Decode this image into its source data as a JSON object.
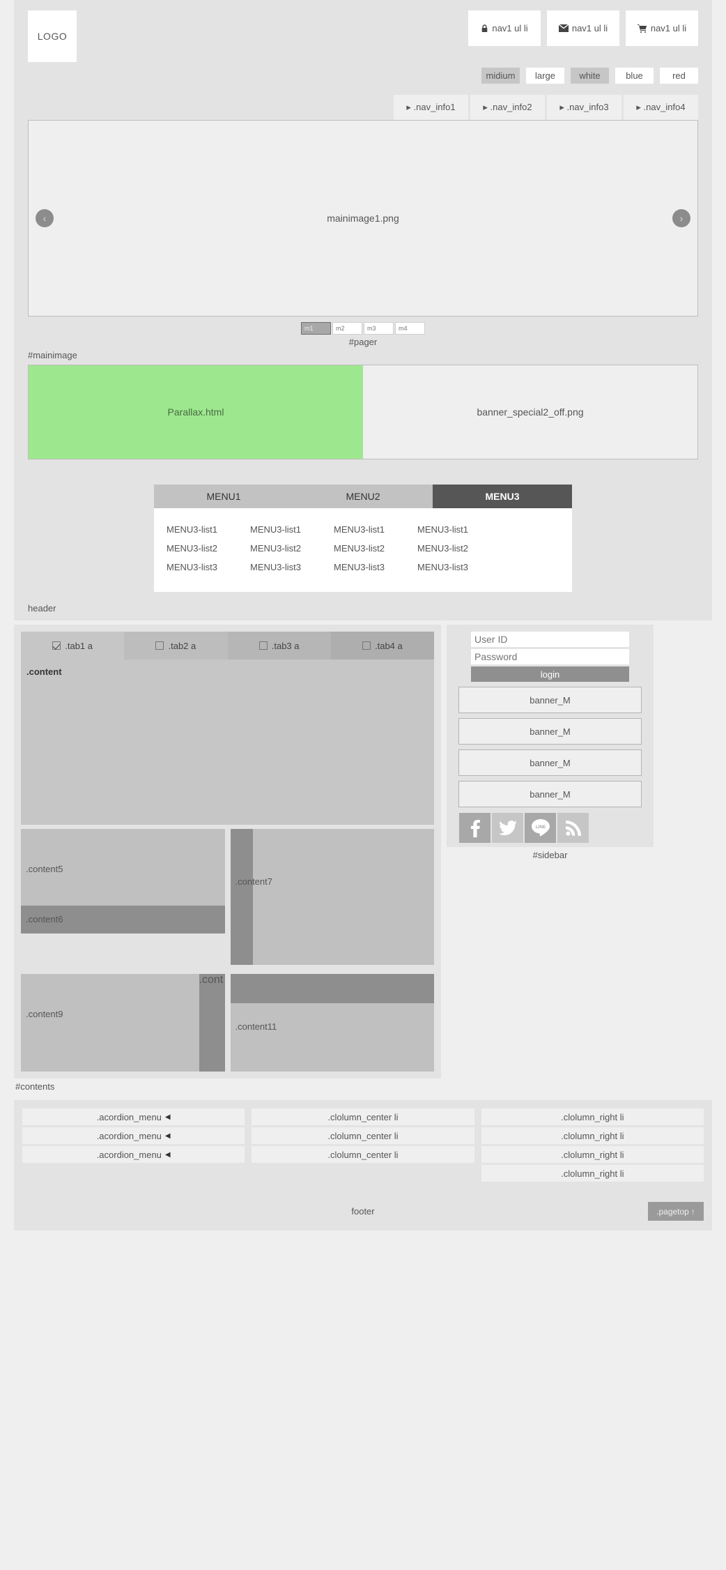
{
  "header": {
    "logo": "LOGO",
    "nav1": [
      {
        "label": "nav1 ul li",
        "icon": "lock-icon"
      },
      {
        "label": "nav1 ul li",
        "icon": "mail-icon"
      },
      {
        "label": "nav1 ul li",
        "icon": "cart-icon"
      }
    ],
    "size_buttons": [
      {
        "label": "midium",
        "active": true
      },
      {
        "label": "large",
        "active": false
      },
      {
        "label": "white",
        "active": true
      },
      {
        "label": "blue",
        "active": false
      },
      {
        "label": "red",
        "active": false
      }
    ],
    "nav_info": [
      "▸ .nav_info1",
      "▸ .nav_info2",
      "▸ .nav_info3",
      "▸ .nav_info4"
    ],
    "label": "header"
  },
  "mainimage": {
    "slide_label": "mainimage1.png",
    "prev_arrow": "‹",
    "next_arrow": "›",
    "pager": [
      {
        "label": "m1",
        "active": true
      },
      {
        "label": "m2",
        "active": false
      },
      {
        "label": "m3",
        "active": false
      },
      {
        "label": "m4",
        "active": false
      }
    ],
    "pager_caption": "#pager",
    "section_label": "#mainimage"
  },
  "parallax": {
    "left_label": "Parallax.html",
    "right_label": "banner_special2_off.png",
    "left_color": "#9de88e"
  },
  "menu": {
    "tabs": [
      {
        "label": "MENU1",
        "active": false
      },
      {
        "label": "MENU2",
        "active": false
      },
      {
        "label": "MENU3",
        "active": true
      }
    ],
    "rows": [
      [
        "MENU3-list1",
        "MENU3-list1",
        "MENU3-list1",
        "MENU3-list1"
      ],
      [
        "MENU3-list2",
        "MENU3-list2",
        "MENU3-list2",
        "MENU3-list2"
      ],
      [
        "MENU3-list3",
        "MENU3-list3",
        "MENU3-list3",
        "MENU3-list3"
      ]
    ]
  },
  "contents": {
    "tabs": [
      {
        "label": ".tab1 a",
        "checked": true
      },
      {
        "label": ".tab2 a",
        "checked": false
      },
      {
        "label": ".tab3 a",
        "checked": false
      },
      {
        "label": ".tab4 a",
        "checked": false
      }
    ],
    "panel_label": ".content",
    "boxes": {
      "content5": ".content5",
      "content6": ".content6",
      "content7": ".content7",
      "content9": ".content9",
      "content10": ".cont",
      "content11": ".content11"
    },
    "label": "#contents"
  },
  "sidebar": {
    "user_id_placeholder": "User ID",
    "password_placeholder": "Password",
    "login_label": "login",
    "banners": [
      "banner_M",
      "banner_M",
      "banner_M",
      "banner_M"
    ],
    "social": [
      {
        "name": "facebook-icon",
        "glyph": "f"
      },
      {
        "name": "twitter-icon",
        "glyph": ""
      },
      {
        "name": "line-icon",
        "glyph": "LINE"
      },
      {
        "name": "rss-icon",
        "glyph": ""
      }
    ],
    "label": "#sidebar"
  },
  "footer": {
    "left_column": [
      ".acordion_menu",
      ".acordion_menu",
      ".acordion_menu"
    ],
    "left_arrow": "◀",
    "center_column": [
      ".clolumn_center li",
      ".clolumn_center li",
      ".clolumn_center li"
    ],
    "right_column": [
      ".clolumn_right li",
      ".clolumn_right li",
      ".clolumn_right li",
      ".clolumn_right li"
    ],
    "label": "footer",
    "pagetop": ".pagetop",
    "pagetop_arrow": "↑"
  }
}
